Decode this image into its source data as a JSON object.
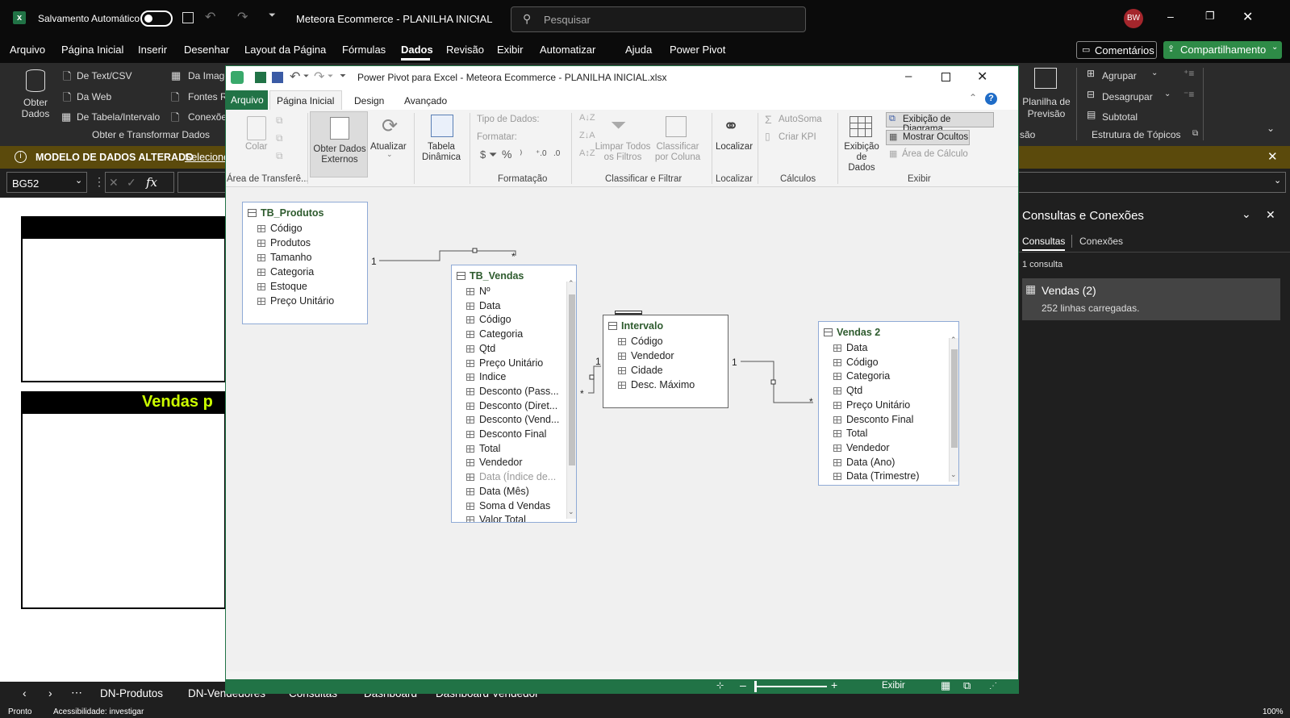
{
  "excel": {
    "autosave_label": "Salvamento Automático",
    "doc_title": "Meteora Ecommerce - PLANILHA INICIAL",
    "search_placeholder": "Pesquisar",
    "user_initials": "BW",
    "menu": [
      "Arquivo",
      "Página Inicial",
      "Inserir",
      "Desenhar",
      "Layout da Página",
      "Fórmulas",
      "Dados",
      "Revisão",
      "Exibir",
      "Automatizar",
      "Ajuda",
      "Power Pivot"
    ],
    "active_menu": "Dados",
    "comments_btn": "Comentários",
    "share_btn": "Compartilhamento",
    "ribbon": {
      "obter_dados": "Obter Dados",
      "de_text_csv": "De Text/CSV",
      "da_web": "Da Web",
      "de_tabela": "De Tabela/Intervalo",
      "da_imagem": "Da Image",
      "fontes": "Fontes R",
      "conexoes": "Conexõe",
      "group_obter": "Obter e Transformar Dados",
      "planilha_previsao": "Planilha de Previsão",
      "agrupar": "Agrupar",
      "desagrupar": "Desagrupar",
      "subtotal": "Subtotal",
      "estrutura": "Estrutura de Tópicos",
      "sao": "são"
    },
    "message": {
      "title": "MODELO DE DADOS ALTERADO",
      "action": "Selecione"
    },
    "name_box": "BG52",
    "sheet_heading": "Vendas p",
    "queries_panel": {
      "title": "Consultas e Conexões",
      "tab_queries": "Consultas",
      "tab_connections": "Conexões",
      "count": "1 consulta",
      "item_name": "Vendas (2)",
      "item_status": "252 linhas carregadas."
    },
    "sheet_tabs": [
      "DN-Produtos",
      "DN-Vendedores",
      "Consultas",
      "Dashboard",
      "Dashboard Vendedor"
    ],
    "status": {
      "ready": "Pronto",
      "accessibility": "Acessibilidade: investigar",
      "zoom": "100%"
    }
  },
  "powerpivot": {
    "title": "Power Pivot para Excel - Meteora Ecommerce - PLANILHA INICIAL.xlsx",
    "tabs": [
      "Arquivo",
      "Página Inicial",
      "Design",
      "Avançado"
    ],
    "buttons": {
      "colar": "Colar",
      "obter_dados_externos": "Obter Dados Externos",
      "atualizar": "Atualizar",
      "tabela_dinamica": "Tabela Dinâmica",
      "tipo_dados": "Tipo de Dados:",
      "formatar": "Formatar:",
      "limpar_filtros": "Limpar Todos os Filtros",
      "classificar_coluna": "Classificar por Coluna",
      "localizar": "Localizar",
      "autosoma": "AutoSoma",
      "criar_kpi": "Criar KPI",
      "exibicao_dados": "Exibição de Dados",
      "exibicao_diagrama": "Exibição de Diagrama",
      "mostrar_ocultos": "Mostrar Ocultos",
      "area_calculo": "Área de Cálculo"
    },
    "groups": {
      "area_transferencia": "Área de Transferê...",
      "formatacao": "Formatação",
      "classificar_filtrar": "Classificar e Filtrar",
      "localizar": "Localizar",
      "calculos": "Cálculos",
      "exibir": "Exibir"
    },
    "tables": {
      "tb_produtos": {
        "name": "TB_Produtos",
        "fields": [
          "Código",
          "Produtos",
          "Tamanho",
          "Categoria",
          "Estoque",
          "Preço Unitário"
        ]
      },
      "tb_vendas": {
        "name": "TB_Vendas",
        "fields": [
          "Nº",
          "Data",
          "Código",
          "Categoria",
          "Qtd",
          "Preço Unitário",
          "Indice",
          "Desconto (Pass...",
          "Desconto (Diret...",
          "Desconto (Vend...",
          "Desconto Final",
          "Total",
          "Vendedor",
          "Data (Índice de...",
          "Data (Mês)",
          "Soma d Vendas",
          "Valor Total"
        ]
      },
      "intervalo": {
        "name": "Intervalo",
        "fields": [
          "Código",
          "Vendedor",
          "Cidade",
          "Desc. Máximo"
        ]
      },
      "vendas2": {
        "name": "Vendas 2",
        "fields": [
          "Data",
          "Código",
          "Categoria",
          "Qtd",
          "Preço Unitário",
          "Desconto Final",
          "Total",
          "Vendedor",
          "Data (Ano)",
          "Data (Trimestre)"
        ]
      }
    },
    "relations": {
      "one": "1",
      "many": "*"
    },
    "status_view": "Exibir"
  },
  "colors": {
    "excel_green": "#217346",
    "accent_yellow": "#ccff00",
    "pp_table_header": "#2e5b2e"
  }
}
